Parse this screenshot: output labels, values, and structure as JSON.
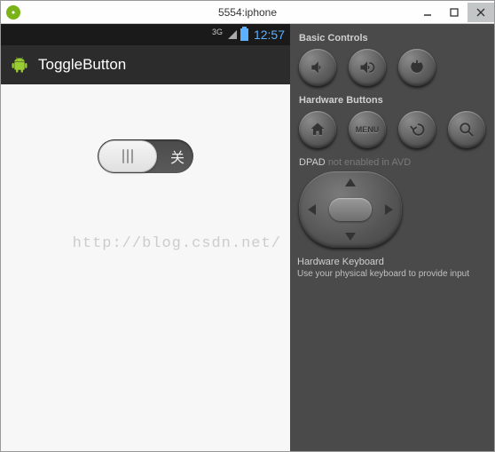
{
  "window": {
    "title": "5554:iphone"
  },
  "statusbar": {
    "network": "3G",
    "time": "12:57"
  },
  "app": {
    "title": "ToggleButton",
    "toggle_state_label": "关"
  },
  "watermark": "http://blog.csdn.net/",
  "panel": {
    "basic_controls": "Basic Controls",
    "hardware_buttons": "Hardware Buttons",
    "menu_label": "MENU",
    "dpad_label": "DPAD",
    "dpad_disabled": "not enabled in AVD",
    "hw_keyboard": "Hardware Keyboard",
    "hw_keyboard_sub": "Use your physical keyboard to provide input"
  }
}
